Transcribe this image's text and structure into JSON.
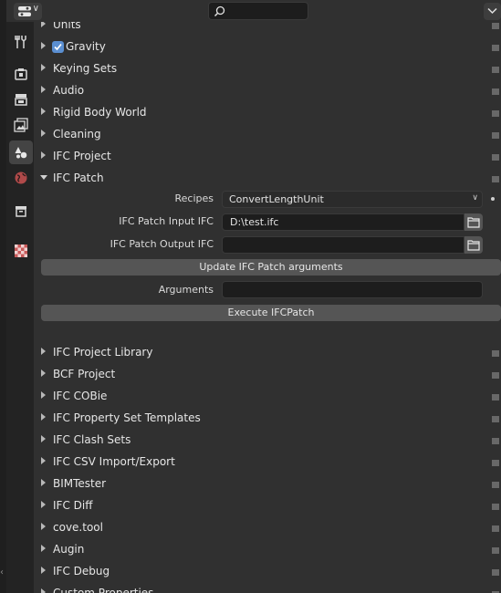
{
  "header": {
    "editor_type_icon": "properties-editor-icon",
    "search_icon": "search-icon",
    "search_value": "",
    "options_icon": "chevron-down-icon"
  },
  "sidebar": {
    "tabs": [
      {
        "icon": "tool-icon",
        "active": false
      },
      {
        "icon": "render-icon",
        "active": false
      },
      {
        "icon": "output-icon",
        "active": false
      },
      {
        "icon": "view-layer-icon",
        "active": false
      },
      {
        "icon": "scene-icon",
        "active": true
      },
      {
        "icon": "world-icon",
        "active": false
      },
      {
        "icon": "collection-icon",
        "active": false
      },
      {
        "icon": "texture-icon",
        "active": false
      }
    ]
  },
  "panels_top": [
    {
      "label": "Units"
    },
    {
      "label": "Gravity",
      "checkbox": true
    },
    {
      "label": "Keying Sets"
    },
    {
      "label": "Audio"
    },
    {
      "label": "Rigid Body World"
    },
    {
      "label": "Cleaning"
    },
    {
      "label": "IFC Project"
    }
  ],
  "ifc_patch": {
    "label": "IFC Patch",
    "recipes_label": "Recipes",
    "recipes_value": "ConvertLengthUnit",
    "input_label": "IFC Patch Input IFC",
    "input_value": "D:\\test.ifc",
    "output_label": "IFC Patch Output IFC",
    "output_value": "",
    "update_button": "Update IFC Patch arguments",
    "arguments_label": "Arguments",
    "arguments_value": "",
    "execute_button": "Execute IFCPatch"
  },
  "panels_bottom": [
    {
      "label": "IFC Project Library"
    },
    {
      "label": "BCF Project"
    },
    {
      "label": "IFC COBie"
    },
    {
      "label": "IFC Property Set Templates"
    },
    {
      "label": "IFC Clash Sets"
    },
    {
      "label": "IFC CSV Import/Export"
    },
    {
      "label": "BIMTester"
    },
    {
      "label": "IFC Diff"
    },
    {
      "label": "cove.tool"
    },
    {
      "label": "Augin"
    },
    {
      "label": "IFC Debug"
    },
    {
      "label": "Custom Properties"
    }
  ],
  "colors": {
    "checkbox": "#5b8fd1",
    "active_tab": "#444444"
  }
}
